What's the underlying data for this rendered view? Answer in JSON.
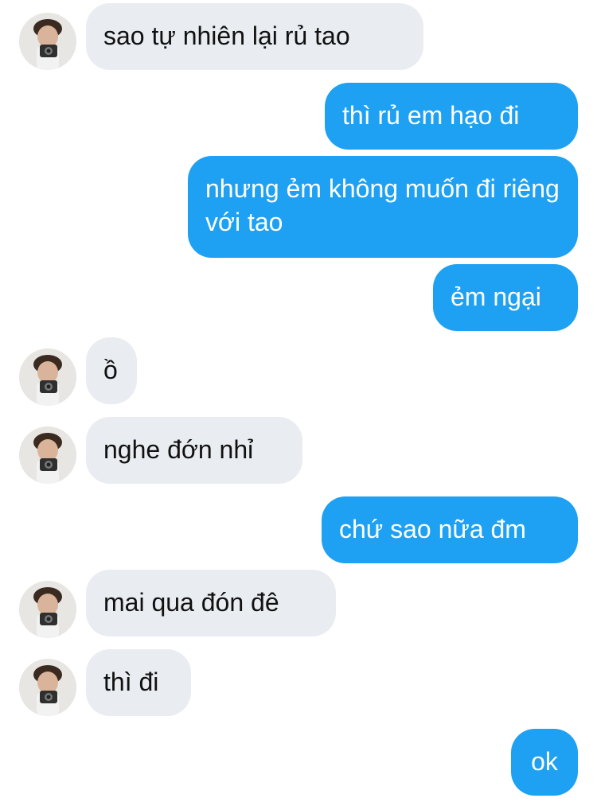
{
  "messages": [
    {
      "id": "m1",
      "side": "incoming",
      "text": "sao tự nhiên lại rủ tao"
    },
    {
      "id": "m2",
      "side": "outgoing",
      "text": "thì rủ em hạo đi"
    },
    {
      "id": "m3",
      "side": "outgoing",
      "text": "nhưng ẻm không muốn đi riêng với tao"
    },
    {
      "id": "m4",
      "side": "outgoing",
      "text": "ẻm ngại"
    },
    {
      "id": "m5",
      "side": "incoming",
      "text": "ồ"
    },
    {
      "id": "m6",
      "side": "incoming",
      "text": "nghe đớn nhỉ"
    },
    {
      "id": "m7",
      "side": "outgoing",
      "text": "chứ sao nữa đm"
    },
    {
      "id": "m8",
      "side": "incoming",
      "text": "mai qua đón đê"
    },
    {
      "id": "m9",
      "side": "incoming",
      "text": "thì đi"
    },
    {
      "id": "m10",
      "side": "outgoing",
      "text": "ok"
    }
  ],
  "colors": {
    "incoming_bubble": "#e9edf1",
    "outgoing_bubble": "#1ea1f2",
    "incoming_text": "#111111",
    "outgoing_text": "#ffffff"
  },
  "avatar_icon": "user-avatar-camera-icon"
}
